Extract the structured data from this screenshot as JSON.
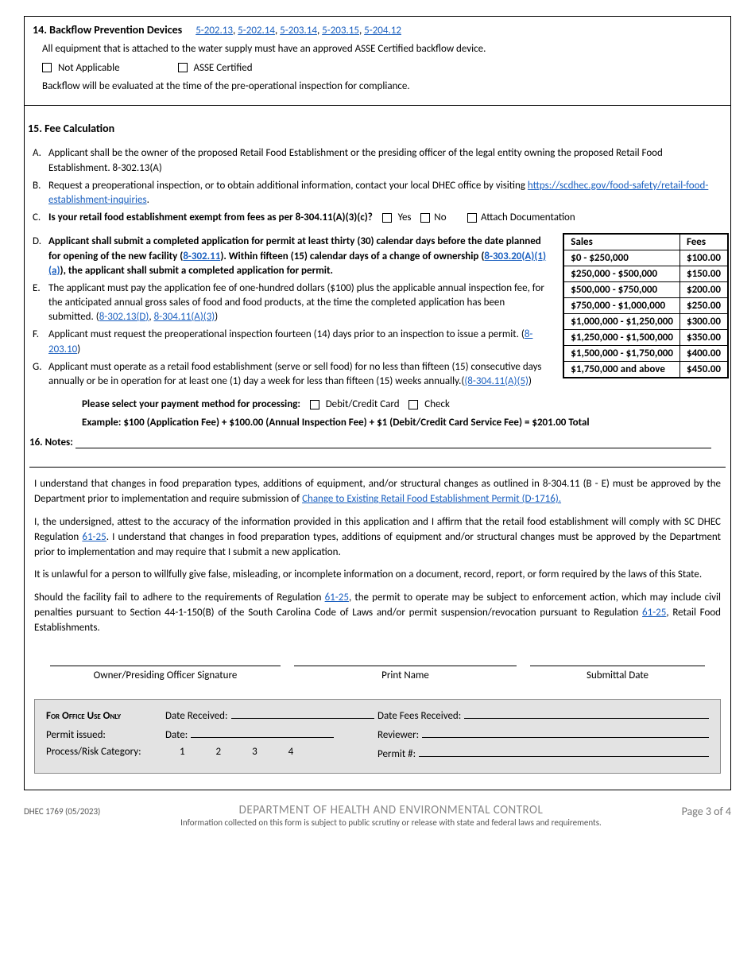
{
  "section14": {
    "title": "14. Backflow Prevention Devices",
    "regs": [
      "5-202.13",
      "5-202.14",
      "5-203.14",
      "5-203.15",
      "5-204.12"
    ],
    "line1": "All equipment that is attached to the water supply must have an approved ASSE Certified backflow device.",
    "cb1": "Not Applicable",
    "cb2": "ASSE Certified",
    "line2": "Backflow will be evaluated at the time of the pre-operational inspection for compliance."
  },
  "section15": {
    "title": "15. Fee Calculation",
    "itemA": "Applicant shall be the owner of the proposed Retail Food Establishment or the presiding officer of the legal entity owning the proposed Retail Food Establishment. 8-302.13(A)",
    "itemB_pre": "Request a preoperational inspection, or to obtain additional information, contact your local DHEC office by visiting ",
    "itemB_link": "https://scdhec.gov/food-safety/retail-food-establishment-inquiries",
    "itemB_post": ".",
    "itemC_text": "Is your retail food establishment exempt from fees as per 8-304.11(A)(3)(c)?",
    "yes": "Yes",
    "no": "No",
    "attach": "Attach Documentation",
    "itemD_pre": "Applicant shall submit a completed application for permit at least thirty (30) calendar days before the date planned for opening of the new facility (",
    "itemD_link1": "8-302.11",
    "itemD_mid": "). Within fifteen (15) calendar days of a change of ownership (",
    "itemD_link2": "8-303.20(A)(1)(a)",
    "itemD_post": "), the applicant shall submit a completed application for permit.",
    "itemE_pre": "The applicant must pay the application fee of one-hundred dollars ($100) plus the applicable annual inspection fee, for the anticipated annual gross sales of food and food products, at the time the completed application has been submitted. (",
    "itemE_link1": "8-302.13(D)",
    "itemE_sep": ", ",
    "itemE_link2": "8-304.11(A)(3)",
    "itemE_post": ")",
    "itemF_pre": "Applicant must request the preoperational inspection fourteen (14) days prior to an inspection to issue a permit. (",
    "itemF_link": "8-203.10",
    "itemF_post": ")",
    "itemG_pre": "Applicant must operate as a retail food establishment (serve or sell food) for no less than fifteen (15) consecutive days annually or be in operation for at least one (1) day a week for less than fifteen (15) weeks annually.(",
    "itemG_link": "(8-304.11(A)(5)",
    "itemG_post": ")",
    "paymentLabel": "Please select your payment method for processing:",
    "debit": "Debit/Credit Card",
    "check": "Check",
    "example": "Example:  $100 (Application Fee)  +  $100.00 (Annual Inspection Fee)  +  $1 (Debit/Credit Card Service Fee)  =  $201.00  Total"
  },
  "feeTable": {
    "headSales": "Sales",
    "headFees": "Fees",
    "rows": [
      {
        "sales": "$0 - $250,000",
        "fee": "$100.00"
      },
      {
        "sales": "$250,000 - $500,000",
        "fee": "$150.00"
      },
      {
        "sales": "$500,000 - $750,000",
        "fee": "$200.00"
      },
      {
        "sales": "$750,000 - $1,000,000",
        "fee": "$250.00"
      },
      {
        "sales": "$1,000,000 - $1,250,000",
        "fee": "$300.00"
      },
      {
        "sales": "$1,250,000 - $1,500,000",
        "fee": "$350.00"
      },
      {
        "sales": "$1,500,000 - $1,750,000",
        "fee": "$400.00"
      },
      {
        "sales": "$1,750,000 and above",
        "fee": "$450.00"
      }
    ]
  },
  "notes": {
    "label": "16. Notes: "
  },
  "attest": {
    "p1_pre": "I understand that changes in food preparation types, additions of equipment, and/or structural changes as outlined in 8-304.11 (B - E) must be approved by the Department prior to implementation and require submission of ",
    "p1_link": "Change to Existing Retail Food Establishment Permit (D-1716).",
    "p2_pre": "I, the undersigned, attest to the accuracy of the information provided in this application and I affirm that the retail food establishment will comply with SC DHEC Regulation ",
    "p2_link": "61-25",
    "p2_post": ". I understand that changes in food preparation types, additions of equipment and/or structural changes must be approved by the Department prior to implementation and may require that I submit a new application.",
    "p3": "It is unlawful for a person to willfully give false, misleading, or incomplete information on a document, record, report, or form required by the laws of this State.",
    "p4_pre": "Should the facility fail to adhere to the requirements of Regulation ",
    "p4_link1": "61-25",
    "p4_mid": ", the permit to operate may be subject to enforcement action, which may include civil penalties pursuant to Section 44-1-150(B) of the South Carolina Code of Laws and/or permit suspension/revocation pursuant to Regulation ",
    "p4_link2": "61-25",
    "p4_post": ", Retail Food Establishments."
  },
  "sig": {
    "owner": "Owner/Presiding Officer Signature",
    "print": "Print Name",
    "date": "Submittal Date"
  },
  "office": {
    "title": "For Office Use Only",
    "dateReceived": "Date Received:",
    "dateFees": "Date Fees Received:",
    "permitIssued": "Permit issued:",
    "date": "Date:",
    "reviewer": "Reviewer:",
    "process": "Process/Risk Category:",
    "n1": "1",
    "n2": "2",
    "n3": "3",
    "n4": "4",
    "permitNum": "Permit #:"
  },
  "footer": {
    "form": "DHEC 1769 (05/2023)",
    "dept": "DEPARTMENT OF HEALTH AND ENVIRONMENTAL CONTROL",
    "sub": "Information collected on this form is subject to public scrutiny or release with state and federal laws and requirements.",
    "page": "Page 3 of 4"
  }
}
